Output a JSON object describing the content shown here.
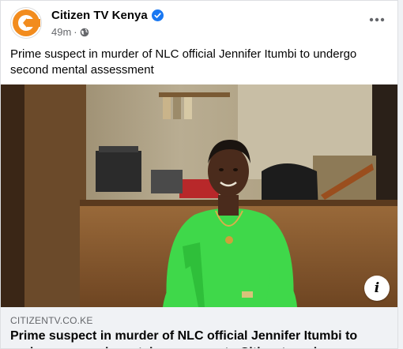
{
  "post": {
    "page_name": "Citizen TV Kenya",
    "time": "49m",
    "separator": "·",
    "text": "Prime suspect in murder of NLC official Jennifer Itumbi to undergo second mental assessment"
  },
  "link": {
    "domain": "CITIZENTV.CO.KE",
    "title": "Prime suspect in murder of NLC official Jennifer Itumbi to undergo second mental assessment - Citizentv.co.ke"
  },
  "icons": {
    "verified": "verified-badge-icon",
    "audience": "globe-icon",
    "more": "more-dots-icon",
    "info": "info-icon"
  },
  "colors": {
    "brand_orange": "#f28c1e",
    "verified_blue": "#1877f2",
    "link_bg": "#f0f2f5",
    "shirt_green": "#3fd84a"
  }
}
